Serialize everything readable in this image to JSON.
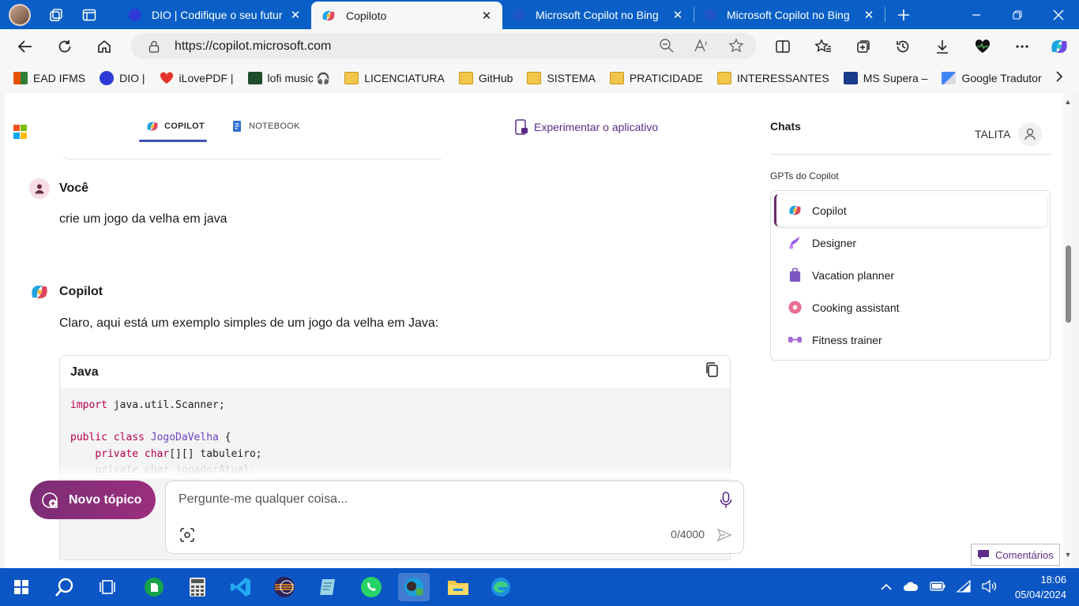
{
  "browser": {
    "tabs": [
      {
        "title": "DIO | Codifique o seu futuro",
        "active": false
      },
      {
        "title": "Copiloto",
        "active": true
      },
      {
        "title": "Microsoft Copilot no Bing",
        "active": false
      },
      {
        "title": "Microsoft Copilot no Bing",
        "active": false
      }
    ],
    "url": "https://copilot.microsoft.com",
    "bookmarks": [
      "EAD IFMS",
      "DIO |",
      "iLovePDF |",
      "lofi music 🎧",
      "LICENCIATURA",
      "GitHub",
      "SISTEMA",
      "PRATICIDADE",
      "INTERESSANTES",
      "MS Supera –",
      "Google Tradutor"
    ]
  },
  "header": {
    "tab_copilot": "COPILOT",
    "tab_notebook": "NOTEBOOK",
    "try_app": "Experimentar o aplicativo"
  },
  "conversation": {
    "user_name": "Você",
    "user_message": "crie um jogo da velha em java",
    "bot_name": "Copilot",
    "bot_message": "Claro, aqui está um exemplo simples de um jogo da velha em Java:",
    "code_language": "Java",
    "code_lines": [
      "import java.util.Scanner;",
      "",
      "public class JogoDaVelha {",
      "    private char[][] tabuleiro;",
      "    private char jogadorAtual;"
    ]
  },
  "composer": {
    "new_topic": "Novo tópico",
    "placeholder": "Pergunte-me qualquer coisa...",
    "counter": "0/4000"
  },
  "sidebar": {
    "title": "Chats",
    "user": "TALITA",
    "section": "GPTs do Copilot",
    "gpts": [
      "Copilot",
      "Designer",
      "Vacation planner",
      "Cooking assistant",
      "Fitness trainer"
    ]
  },
  "feedback": "Comentários",
  "taskbar": {
    "time": "18:06",
    "date": "05/04/2024"
  }
}
